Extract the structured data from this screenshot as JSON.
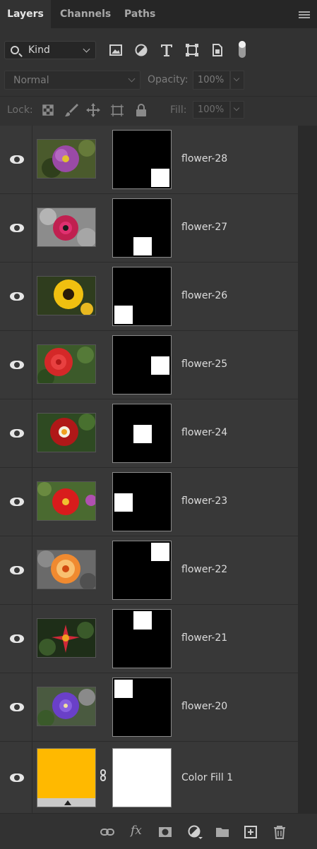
{
  "tabs": [
    {
      "label": "Layers",
      "active": true
    },
    {
      "label": "Channels",
      "active": false
    },
    {
      "label": "Paths",
      "active": false
    }
  ],
  "filter": {
    "kind_label": "Kind",
    "icons": [
      "image-filter-icon",
      "adjustment-filter-icon",
      "type-filter-icon",
      "shape-filter-icon",
      "smart-object-filter-icon",
      "filter-toggle-icon"
    ]
  },
  "blend": {
    "mode": "Normal",
    "opacity_label": "Opacity:",
    "opacity_value": "100%"
  },
  "lock": {
    "label": "Lock:",
    "fill_label": "Fill:",
    "fill_value": "100%"
  },
  "layers": [
    {
      "name": "flower-28",
      "mask_corner": "bottom-right"
    },
    {
      "name": "flower-27",
      "mask_corner": "bottom-center"
    },
    {
      "name": "flower-26",
      "mask_corner": "bottom-left"
    },
    {
      "name": "flower-25",
      "mask_corner": "middle-right"
    },
    {
      "name": "flower-24",
      "mask_corner": "center"
    },
    {
      "name": "flower-23",
      "mask_corner": "middle-left"
    },
    {
      "name": "flower-22",
      "mask_corner": "top-right"
    },
    {
      "name": "flower-21",
      "mask_corner": "top-center"
    },
    {
      "name": "flower-20",
      "mask_corner": "top-left"
    }
  ],
  "fill_layer": {
    "name": "Color Fill 1",
    "color": "#ffb900"
  },
  "bottom_icons": [
    "link-layers-icon",
    "fx-icon",
    "add-mask-icon",
    "new-adjustment-icon",
    "new-group-icon",
    "new-layer-icon",
    "delete-layer-icon"
  ],
  "colors": {
    "panel": "#323232",
    "list": "#383838",
    "tabbar": "#262626"
  }
}
